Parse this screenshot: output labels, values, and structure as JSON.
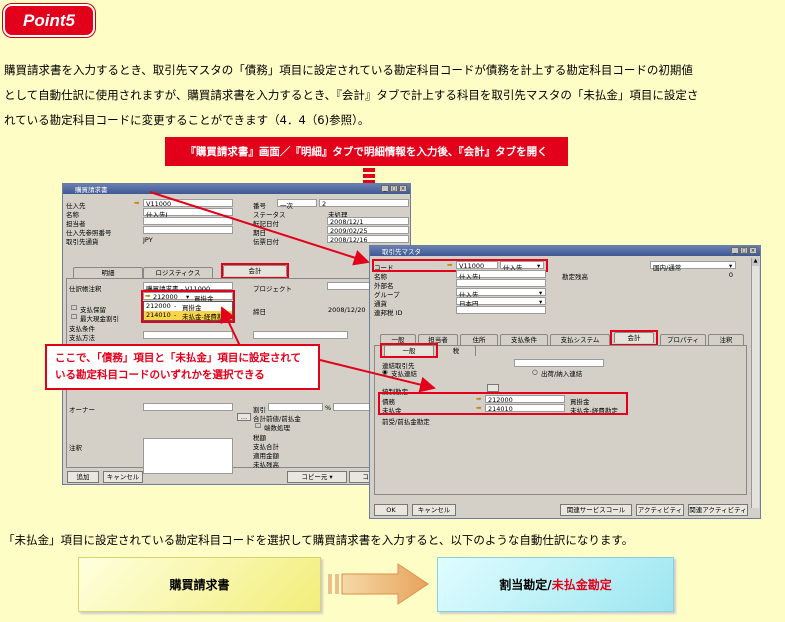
{
  "point": {
    "label": "Point5"
  },
  "paragraph": {
    "line1": "購買請求書を入力するとき、取引先マスタの「債務」項目に設定されている勘定科目コードが債務を計上する勘定科目コードの初期値",
    "line2": "として自動仕訳に使用されますが、購買請求書を入力するとき、『会計』タブで計上する科目を取引先マスタの「未払金」項目に設定さ",
    "line3": "れている勘定科目コードに変更することができます（4．4（6)参照）。"
  },
  "caption_top": "『購買請求書』画面／『明細』タブで明細情報を入力後、『会計』タブを開く",
  "invoice_window": {
    "title": "購買請求書",
    "fields": {
      "vendor_label": "仕入先",
      "vendor_value": "V11000",
      "name_label": "名称",
      "name_value": "仕入先J",
      "contact_label": "担当者",
      "vendor_ref_label": "仕入先参照番号",
      "currency_label": "取引先通貨",
      "currency_value": "JPY",
      "number_label": "番号",
      "number_series": "一次",
      "number_value": "2",
      "status_label": "ステータス",
      "status_value": "未処理",
      "posting_date_label": "転記日付",
      "posting_date_value": "2008/12/1",
      "due_date_label": "期日",
      "due_date_value": "2009/02/25",
      "doc_date_label": "伝票日付",
      "doc_date_value": "2008/12/16"
    },
    "tabs": [
      "明細",
      "ロジスティクス",
      "会計"
    ],
    "accounting": {
      "journal_remark_label": "仕訳帳注釈",
      "journal_remark_value": "購買請求書 - V11000",
      "payment_hold_label": "支払保留",
      "max_cash_discount_label": "最大現金割引",
      "payment_terms_label": "支払条件",
      "payment_method_label": "支払方法",
      "project_label": "プロジェクト",
      "dropdown_current": "212000",
      "dropdown_current_name": "買掛金",
      "dropdown_options": [
        {
          "code": "212000",
          "name": "買掛金"
        },
        {
          "code": "214010",
          "name": "未払金-経費勘定"
        }
      ],
      "date_label": "締日",
      "date_value": "2008/12/20"
    },
    "lower": {
      "owner_label": "オーナー",
      "remarks_label": "注釈",
      "discount_label": "割引",
      "discount_unit": "%",
      "total_before_label": "合計前値/前払金",
      "rounding_label": "端数処理",
      "tax_label": "税額",
      "payment_total_label": "支払合計",
      "applied_label": "適用金額",
      "balance_label": "未払残高"
    },
    "buttons": {
      "add": "追加",
      "cancel": "キャンセル",
      "copy_from": "コピー元",
      "copy_to": "コピー先"
    }
  },
  "callout": {
    "line1": "ここで、「債務」項目と「未払金」項目に設定されて",
    "line2": "いる勘定科目コードのいずれかを選択できる"
  },
  "bp_window": {
    "title": "取引先マスタ",
    "code_label": "コード",
    "code_value": "V11000",
    "code_type": "仕入先",
    "name_label": "名称",
    "name_value": "仕入先J",
    "foreign_name_label": "外部名",
    "group_label": "グループ",
    "group_value": "仕入先",
    "currency_label": "通貨",
    "currency_value": "日本円",
    "tax_id_label": "連邦税 ID",
    "balance_label": "勘定残高",
    "balance_value": "0",
    "domestic_label": "国内/通常",
    "tabs": [
      "一般",
      "担当者",
      "住所",
      "支払条件",
      "支払システム",
      "会計",
      "プロパティ",
      "注釈"
    ],
    "subtabs": [
      "一般",
      "税"
    ],
    "consolidation_label": "連結取引先",
    "consolidation_option1": "支払連結",
    "consolidation_option2": "出荷/納入連結",
    "control_accounts_label": "統制勘定",
    "payable_label": "債務",
    "payable_code": "212000",
    "payable_name": "買掛金",
    "unpaid_label": "未払金",
    "unpaid_code": "214010",
    "unpaid_name": "未払金-経費勘定",
    "advance_label": "前受/前払金勘定",
    "buttons": {
      "ok": "OK",
      "cancel": "キャンセル",
      "service_call": "関連サービスコール",
      "activity": "アクティビティ",
      "related_activity": "関連アクティビティ"
    }
  },
  "bottom_text": "「未払金」項目に設定されている勘定科目コードを選択して購買請求書を入力すると、以下のような自動仕訳になります。",
  "flow": {
    "left": "購買請求書",
    "right_prefix": "割当勘定/",
    "right_highlight": "未払金勘定"
  },
  "colors": {
    "accent_red": "#E3001B",
    "background": "#FFFDC6"
  }
}
